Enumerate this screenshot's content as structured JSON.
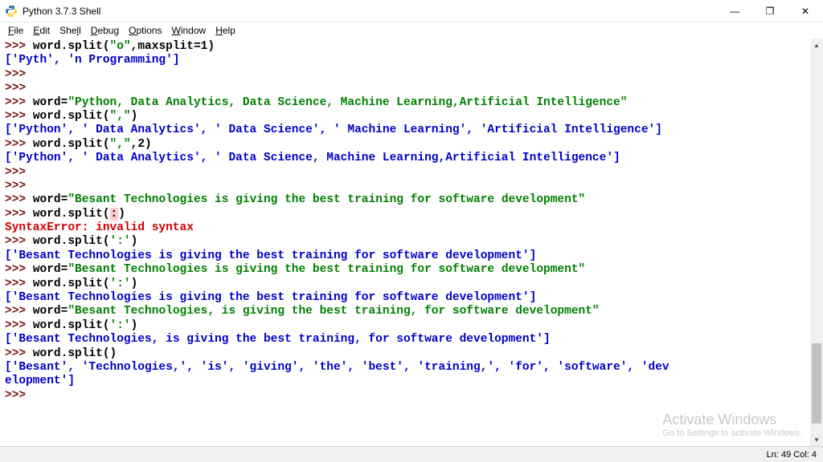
{
  "window": {
    "title": "Python 3.7.3 Shell"
  },
  "menu": {
    "file": "File",
    "edit": "Edit",
    "shell": "Shell",
    "debug": "Debug",
    "options": "Options",
    "window": "Window",
    "help": "Help"
  },
  "lines": {
    "l0_prompt": ">>> ",
    "l0_code1": "word.split(",
    "l0_str1": "\"o\"",
    "l0_code2": ",maxsplit=1)",
    "l1_out": "['Pyth', 'n Programming']",
    "l2_prompt": ">>>",
    "l3_prompt": ">>>",
    "l4_prompt": ">>> ",
    "l4_code": "word=",
    "l4_str": "\"Python, Data Analytics, Data Science, Machine Learning,Artificial Intelligence\"",
    "l5_prompt": ">>> ",
    "l5_code1": "word.split(",
    "l5_str": "\",\"",
    "l5_code2": ")",
    "l6_out": "['Python', ' Data Analytics', ' Data Science', ' Machine Learning', 'Artificial Intelligence']",
    "l7_prompt": ">>> ",
    "l7_code1": "word.split(",
    "l7_str": "\",\"",
    "l7_code2": ",2)",
    "l8_out": "['Python', ' Data Analytics', ' Data Science, Machine Learning,Artificial Intelligence']",
    "l9_prompt": ">>>",
    "l10_prompt": ">>>",
    "l11_prompt": ">>> ",
    "l11_code": "word=",
    "l11_str": "\"Besant Technologies is giving the best training for software development\"",
    "l12_prompt": ">>> ",
    "l12_code1": "word.split(",
    "l12_hl": ":",
    "l12_code2": ")",
    "l13_err": "SyntaxError: invalid syntax",
    "l14_prompt": ">>> ",
    "l14_code1": "word.split(",
    "l14_str": "':'",
    "l14_code2": ")",
    "l15_out": "['Besant Technologies is giving the best training for software development']",
    "l16_prompt": ">>> ",
    "l16_code": "word=",
    "l16_str": "\"Besant Technologies is giving the best training for software development\"",
    "l17_prompt": ">>> ",
    "l17_code1": "word.split(",
    "l17_str": "':'",
    "l17_code2": ")",
    "l18_out": "['Besant Technologies is giving the best training for software development']",
    "l19_prompt": ">>> ",
    "l19_code": "word=",
    "l19_str": "\"Besant Technologies, is giving the best training, for software development\"",
    "l20_prompt": ">>> ",
    "l20_code1": "word.split(",
    "l20_str": "':'",
    "l20_code2": ")",
    "l21_out": "['Besant Technologies, is giving the best training, for software development']",
    "l22_prompt": ">>> ",
    "l22_code": "word.split()",
    "l23_out": "['Besant', 'Technologies,', 'is', 'giving', 'the', 'best', 'training,', 'for', 'software', 'dev\nelopment']",
    "l24_prompt": ">>>"
  },
  "status": {
    "pos": "Ln: 49  Col: 4"
  },
  "watermark": {
    "title": "Activate Windows",
    "sub": "Go to Settings to activate Windows."
  }
}
